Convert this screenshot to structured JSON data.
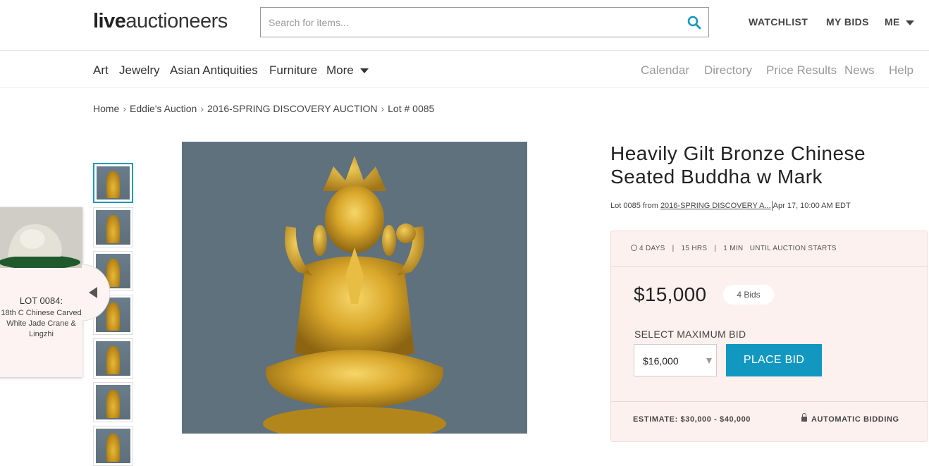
{
  "header": {
    "logo_bold": "live",
    "logo_light": "auctioneers",
    "search_placeholder": "Search for items...",
    "watchlist": "WATCHLIST",
    "my_bids": "MY BIDS",
    "me": "ME"
  },
  "nav": {
    "categories": [
      "Art",
      "Jewelry",
      "Asian Antiquities",
      "Furniture",
      "More"
    ],
    "utility": [
      "Calendar",
      "Directory",
      "Price Results",
      "News",
      "Help"
    ]
  },
  "breadcrumb": [
    "Home",
    "Eddie's Auction",
    "2016-SPRING DISCOVERY AUCTION",
    "Lot # 0085"
  ],
  "prev_lot": {
    "label": "LOT 0084:",
    "title": "18th C Chinese Carved White Jade Crane & Lingzhi"
  },
  "item": {
    "title": "Heavily Gilt Bronze Chinese Seated Buddha w Mark",
    "lot_prefix": "Lot 0085 from",
    "auction_link": "2016-SPRING DISCOVERY A...",
    "date": "Apr 17, 10:00 AM EDT"
  },
  "bidding": {
    "days": "4 DAYS",
    "hrs": "15 HRS",
    "min": "1 MIN",
    "until": "UNTIL AUCTION STARTS",
    "price": "$15,000",
    "bids": "4 Bids",
    "select_label": "SELECT MAXIMUM BID",
    "selected_bid": "$16,000",
    "place_bid": "PLACE BID",
    "estimate": "ESTIMATE: $30,000 - $40,000",
    "auto_bidding": "AUTOMATIC BIDDING"
  },
  "colors": {
    "accent": "#1298c0",
    "panel_bg": "#fdf1ef"
  }
}
